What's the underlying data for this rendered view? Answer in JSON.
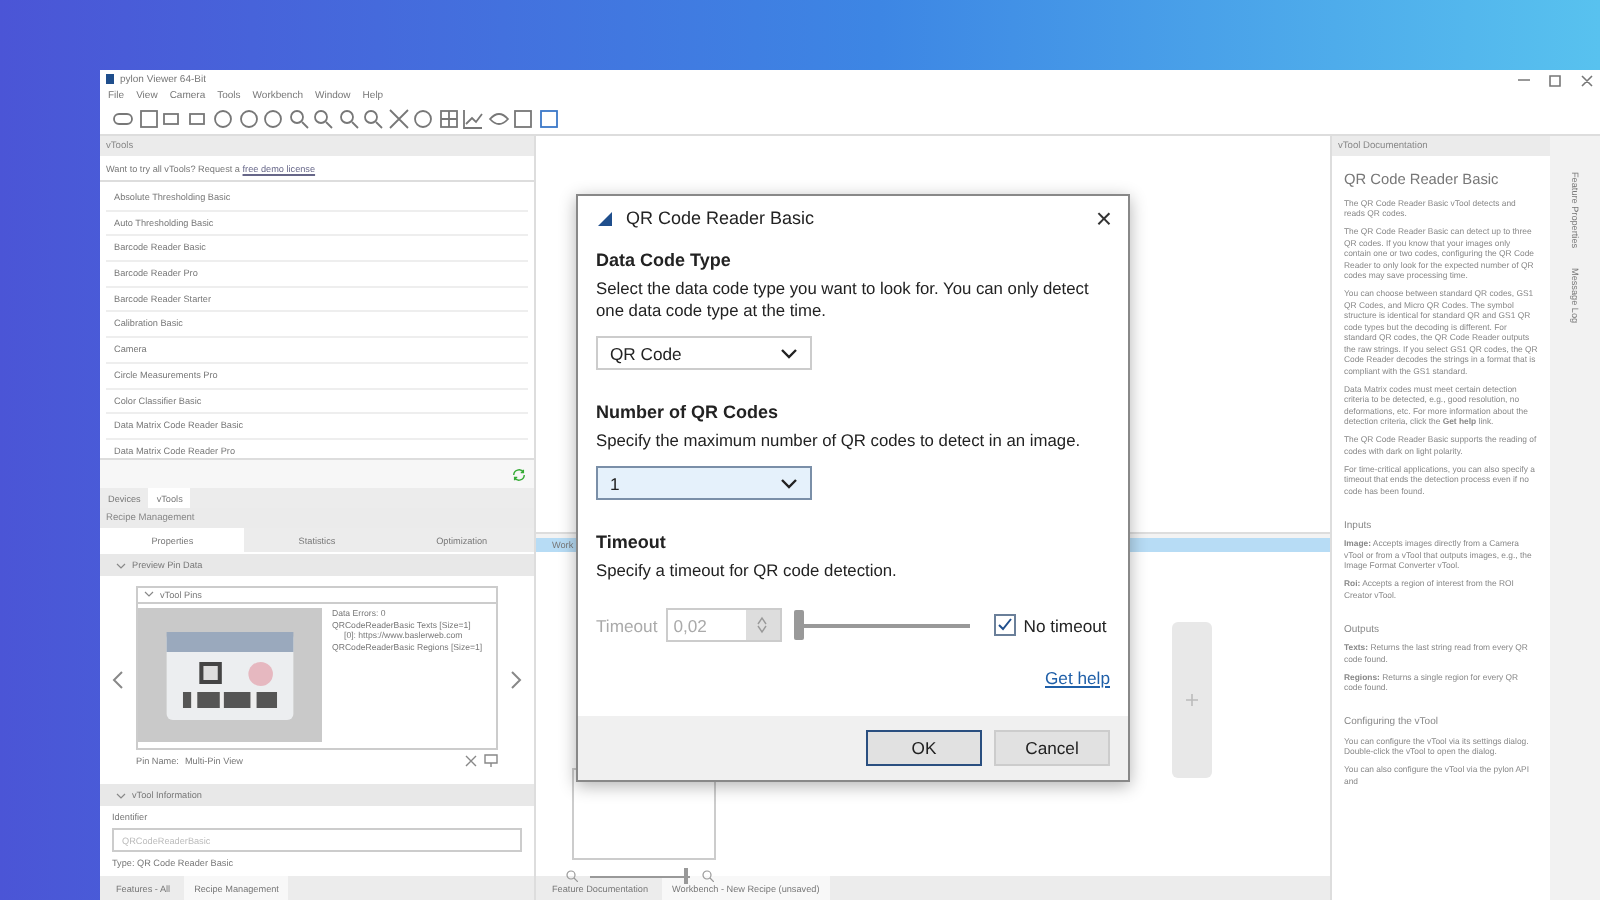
{
  "window": {
    "title": "pylon Viewer 64-Bit"
  },
  "menu": [
    "File",
    "View",
    "Camera",
    "Tools",
    "Workbench",
    "Window",
    "Help"
  ],
  "vtools_panel": {
    "title": "vTools",
    "hint": "Want to try all vTools? Request a",
    "hint_link": "free demo license",
    "items": [
      "Absolute Thresholding Basic",
      "Auto Thresholding Basic",
      "Barcode Reader Basic",
      "Barcode Reader Pro",
      "Barcode Reader Starter",
      "Calibration Basic",
      "Camera",
      "Circle Measurements Pro",
      "Color Classifier Basic",
      "Data Matrix Code Reader Basic",
      "Data Matrix Code Reader Pro"
    ]
  },
  "left_tabs": [
    {
      "label": "Devices",
      "selected": false
    },
    {
      "label": "vTools",
      "selected": true
    }
  ],
  "recipe_panel": {
    "title": "Recipe Management",
    "tabs": [
      {
        "label": "Properties",
        "selected": true
      },
      {
        "label": "Statistics",
        "selected": false
      },
      {
        "label": "Optimization",
        "selected": false
      }
    ],
    "preview_section": "Preview Pin Data",
    "pins_title": "vTool Pins",
    "pin_lines": [
      "Data Errors: 0",
      "QRCodeReaderBasic Texts [Size=1]",
      "[0]: https://www.baslerweb.com",
      "QRCodeReaderBasic Regions [Size=1]"
    ],
    "pin_name_label": "Pin Name:",
    "pin_name": "Multi-Pin View",
    "info_section": "vTool Information",
    "identifier_label": "Identifier",
    "identifier_value": "QRCodeReaderBasic",
    "type_line": "Type: QR Code Reader Basic"
  },
  "bottom_tabs_left": [
    {
      "label": "Features - All",
      "selected": false
    },
    {
      "label": "Recipe Management",
      "selected": true
    }
  ],
  "workbench": {
    "title": "Work",
    "zoom": {
      "level": 0.95
    }
  },
  "bottom_tabs_center": [
    {
      "label": "Feature Documentation",
      "selected": false
    },
    {
      "label": "Workbench - New Recipe (unsaved)",
      "selected": true
    }
  ],
  "doc_panel": {
    "title": "vTool Documentation",
    "heading": "QR Code Reader Basic",
    "blocks": [
      {
        "kind": "p",
        "text": "The QR Code Reader Basic vTool detects and reads QR codes."
      },
      {
        "kind": "p",
        "text": "The QR Code Reader Basic can detect up to three QR codes. If you know that your images only contain one or two codes, configuring the QR Code Reader to only look for the expected number of QR codes may save processing time."
      },
      {
        "kind": "p",
        "text": "You can choose between standard QR codes, GS1 QR Codes, and Micro QR Codes. The symbol structure is identical for standard QR and GS1 QR code types but the decoding is different. For standard QR codes, the QR Code Reader outputs the raw strings. If you select GS1 QR codes, the QR Code Reader decodes the strings in a format that is compliant with the GS1 standard."
      },
      {
        "kind": "p",
        "text": "Data Matrix codes must meet certain detection criteria to be detected, e.g., good resolution, no deformations, etc. For more information about the detection criteria, click the **Get help** link."
      },
      {
        "kind": "p",
        "text": "The QR Code Reader Basic supports the reading of codes with dark on light polarity."
      },
      {
        "kind": "p",
        "text": "For time-critical applications, you can also specify a timeout that ends the detection process even if no code has been found."
      },
      {
        "kind": "h",
        "text": "Inputs"
      },
      {
        "kind": "p",
        "text": "**Image:** Accepts images directly from a Camera vTool or from a vTool that outputs images, e.g., the Image Format Converter vTool."
      },
      {
        "kind": "p",
        "text": "**Roi:** Accepts a region of interest from the ROI Creator vTool."
      },
      {
        "kind": "h",
        "text": "Outputs"
      },
      {
        "kind": "p",
        "text": "**Texts:** Returns the last string read from every QR code found."
      },
      {
        "kind": "p",
        "text": "**Regions:** Returns a single region for every QR code found."
      },
      {
        "kind": "h",
        "text": "Configuring the vTool"
      },
      {
        "kind": "p",
        "text": "You can configure the vTool via its settings dialog. Double-click the vTool to open the dialog."
      },
      {
        "kind": "p",
        "text": "You can also configure the vTool via the pylon API and"
      }
    ]
  },
  "side_tabs": [
    "Feature Properties",
    "Message Log"
  ],
  "dialog": {
    "title": "QR Code Reader Basic",
    "close": "×",
    "type_heading": "Data Code Type",
    "type_desc": "Select the data code type you want to look for. You can only detect one data code type at the time.",
    "type_value": "QR Code",
    "count_heading": "Number of QR Codes",
    "count_desc": "Specify the maximum number of QR codes to detect in an image.",
    "count_value": "1",
    "count_focused": true,
    "timeout_heading": "Timeout",
    "timeout_desc": "Specify a timeout for QR code detection.",
    "timeout_label": "Timeout",
    "timeout_value": "0,02",
    "timeout_disabled": true,
    "timeout_slider": {
      "level": 0
    },
    "no_timeout": {
      "label": "No timeout",
      "checked": true
    },
    "help_link": "Get help",
    "ok": "OK",
    "cancel": "Cancel"
  }
}
